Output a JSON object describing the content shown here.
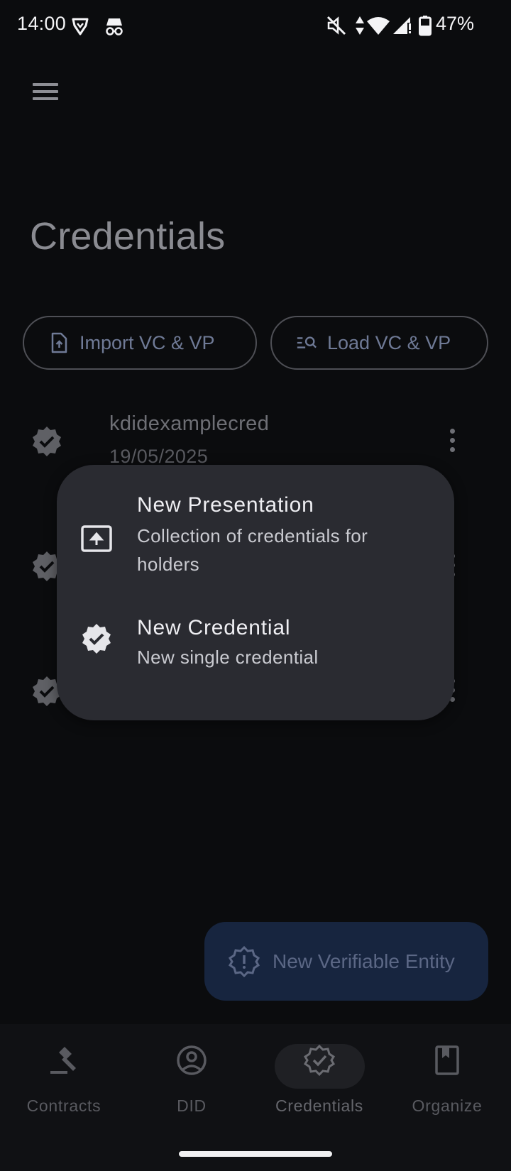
{
  "status_bar": {
    "time": "14:00",
    "battery_percent": "47%",
    "icons": [
      "brave-icon",
      "incognito-icon",
      "mute-icon",
      "data-arrows-icon",
      "wifi-icon",
      "signal-icon",
      "battery-icon"
    ]
  },
  "header": {
    "menu_icon": "hamburger-menu-icon",
    "title": "Credentials"
  },
  "actions": {
    "import_label": "Import VC & VP",
    "load_label": "Load VC & VP"
  },
  "credentials_list": [
    {
      "name": "kdidexamplecred",
      "date": "19/05/2025"
    },
    {
      "name": "",
      "date": ""
    },
    {
      "name": "",
      "date": ""
    }
  ],
  "popup_menu": {
    "items": [
      {
        "icon": "upload-box-icon",
        "title": "New Presentation",
        "subtitle": "Collection of credentials for holders"
      },
      {
        "icon": "verified-badge-icon",
        "title": "New Credential",
        "subtitle": "New single credential"
      }
    ]
  },
  "fab": {
    "icon": "alert-badge-icon",
    "label": "New Verifiable Entity"
  },
  "bottom_nav": {
    "items": [
      {
        "label": "Contracts",
        "icon": "gavel-icon"
      },
      {
        "label": "DID",
        "icon": "account-circle-icon"
      },
      {
        "label": "Credentials",
        "icon": "verified-badge-icon"
      },
      {
        "label": "Organize",
        "icon": "bookmark-book-icon"
      }
    ],
    "active": "Credentials"
  },
  "colors": {
    "background": "#0b0c0e",
    "popup": "#2a2b31",
    "fab": "#17253f",
    "accent_text": "#6f7a96"
  }
}
